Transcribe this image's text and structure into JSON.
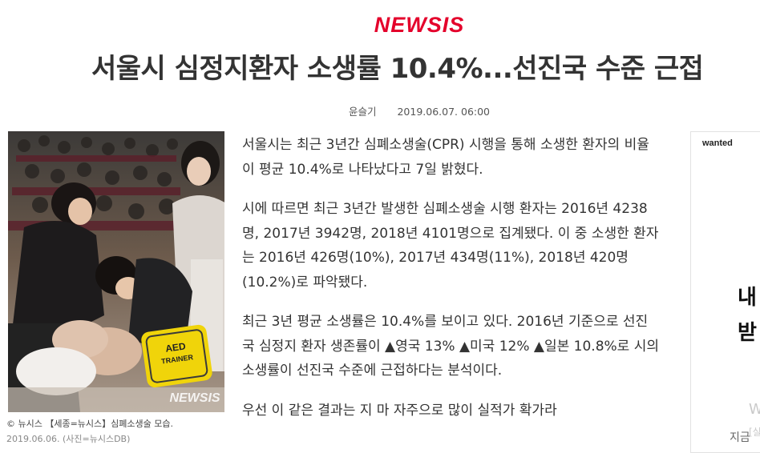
{
  "header": {
    "logo_text": "NEWSIS",
    "headline": "서울시 심정지환자 소생률 10.4%...선진국 수준 근접",
    "reporter": "윤슬기",
    "datetime": "2019.06.07. 06:00"
  },
  "photo": {
    "watermark": "NEWSIS",
    "aed_label_1": "AED",
    "aed_label_2": "TRAINER",
    "caption_line1": "© 뉴시스  【세종=뉴시스】심폐소생술 모습.",
    "caption_line2": "2019.06.06. (사진=뉴시스DB)"
  },
  "article": {
    "paragraphs": [
      "서울시는 최근 3년간 심폐소생술(CPR) 시행을 통해 소생한 환자의 비율이 평균 10.4%로 나타났다고 7일 밝혔다.",
      "시에 따르면 최근 3년간 발생한 심폐소생술 시행 환자는 2016년 4238명, 2017년 3942명, 2018년 4101명으로 집계됐다. 이 중 소생한 환자는 2016년 426명(10%), 2017년 434명(11%), 2018년 420명(10.2%)로 파악됐다.",
      "최근 3년 평균 소생률은 10.4%를 보이고 있다. 2016년 기준으로 선진국 심정지 환자 생존률이 ▲영국 13% ▲미국 12% ▲일본 10.8%로 시의 소생률이 선진국 수준에 근접하다는 분석이다.",
      "우선 이 같은 결과는 지 마 자주으로      많이 실적가 확가라"
    ]
  },
  "sidebar_ad": {
    "brand": "wanted",
    "headline_1": "내",
    "headline_2": "받",
    "faint_1": "W",
    "faint_2": "[실",
    "faint_3": "지금"
  }
}
